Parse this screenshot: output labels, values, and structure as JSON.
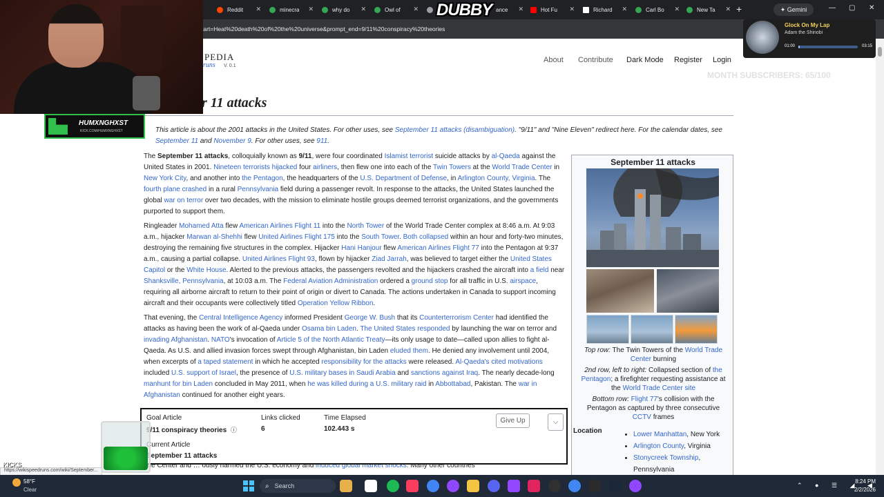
{
  "browser": {
    "tabs": [
      {
        "label": "Reddit",
        "color": "#ff4500"
      },
      {
        "label": "minecra",
        "color": "#34a853"
      },
      {
        "label": "why do",
        "color": "#34a853"
      },
      {
        "label": "Owl of",
        "color": "#34a853"
      },
      {
        "label": "",
        "color": "#9aa0a6"
      },
      {
        "label": "ance",
        "color": "#9aa0a6"
      },
      {
        "label": "Hot Fu",
        "color": "#ff0000"
      },
      {
        "label": "Richard",
        "color": "#ffffff"
      },
      {
        "label": "Carl Bo",
        "color": "#34a853"
      },
      {
        "label": "New Ta",
        "color": "#34a853"
      }
    ],
    "new_tab": "+",
    "gemini": "✦ Gemini",
    "minimize": "—",
    "maximize": "▢",
    "close": "✕",
    "url": "tart=Heat%20death%20of%20the%20universe&prompt_end=9/11%20conspiracy%20theories"
  },
  "site": {
    "logo": "PEDIA",
    "logo_sub": "runs",
    "version": "V. 0.1",
    "nav": [
      "About",
      "Contribute",
      "Dark Mode",
      "Register",
      "Login"
    ]
  },
  "article": {
    "title": "r 11 attacks",
    "hatnote_html": "This article is about the 2001 attacks in the United States. For other uses, see <span class=\"lnk\">September 11 attacks (disambiguation)</span>. \"9/11\" and \"Nine Eleven\" redirect here. For the calendar dates, see <span class=\"lnk\">September 11</span> and <span class=\"lnk\">November 9</span>. For other uses, see <span class=\"lnk\">911</span>.",
    "paragraphs": [
      "The <b>September 11 attacks</b>, colloquially known as <b>9/11</b>, were four coordinated <span class=\"lnk\">Islamist terrorist</span> suicide attacks by <span class=\"lnk\">al-Qaeda</span> against the United States in 2001. <span class=\"lnk\">Nineteen terrorists hijacked</span> four <span class=\"lnk\">airliners</span>, then flew one into each of the <span class=\"lnk\">Twin Towers</span> at the <span class=\"lnk\">World Trade Center</span> in <span class=\"lnk\">New York City</span>, and another into <span class=\"lnk\">the Pentagon</span>, the headquarters of the <span class=\"lnk\">U.S. Department of Defense</span>, in <span class=\"lnk\">Arlington County, Virginia</span>. The <span class=\"lnk\">fourth plane crashed</span> in a rural <span class=\"lnk\">Pennsylvania</span> field during a passenger revolt. In response to the attacks, the United States launched the global <span class=\"lnk\">war on terror</span> over two decades, with the mission to eliminate hostile groups deemed terrorist organizations, and the governments purported to support them.",
      "Ringleader <span class=\"lnk\">Mohamed Atta</span> flew <span class=\"lnk\">American Airlines Flight 11</span> into the <span class=\"lnk\">North Tower</span> of the World Trade Center complex at 8:46 a.m. At 9:03 a.m., hijacker <span class=\"lnk\">Marwan al-Shehhi</span> flew <span class=\"lnk\">United Airlines Flight 175</span> into the <span class=\"lnk\">South Tower</span>. <span class=\"lnk\">Both collapsed</span> within an hour and forty-two minutes, destroying the remaining five structures in the complex. Hijacker <span class=\"lnk\">Hani Hanjour</span> flew <span class=\"lnk\">American Airlines Flight 77</span> into the Pentagon at 9:37 a.m., causing a partial collapse. <span class=\"lnk\">United Airlines Flight 93</span>, flown by hijacker <span class=\"lnk\">Ziad Jarrah</span>, was believed to target either the <span class=\"lnk\">United States Capitol</span> or the <span class=\"lnk\">White House</span>. Alerted to the previous attacks, the passengers revolted and the hijackers crashed the aircraft into <span class=\"lnk\">a field</span> near <span class=\"lnk\">Shanksville, Pennsylvania</span>, at 10:03 a.m. The <span class=\"lnk\">Federal Aviation Administration</span> ordered a <span class=\"lnk\">ground stop</span> for all traffic in U.S. <span class=\"lnk\">airspace</span>, requiring all airborne aircraft to return to their point of origin or divert to Canada. The actions undertaken in Canada to support incoming aircraft and their occupants were collectively titled <span class=\"lnk\">Operation Yellow Ribbon</span>.",
      "That evening, the <span class=\"lnk\">Central Intelligence Agency</span> informed President <span class=\"lnk\">George W. Bush</span> that its <span class=\"lnk\">Counterterrorism Center</span> had identified the attacks as having been the work of al-Qaeda under <span class=\"lnk\">Osama bin Laden</span>. <span class=\"lnk\">The United States responded</span> by launching the war on terror and <span class=\"lnk\">invading Afghanistan</span>. <span class=\"lnk\">NATO</span>'s invocation of <span class=\"lnk\">Article 5 of the North Atlantic Treaty</span>—its only usage to date—called upon allies to fight al-Qaeda. As U.S. and allied invasion forces swept through Afghanistan, bin Laden <span class=\"lnk\">eluded them</span>. He denied any involvement until 2004, when excerpts of <span class=\"lnk\">a taped statement</span> in which he accepted <span class=\"lnk\">responsibility for the attacks</span> were released. <span class=\"lnk\">Al-Qaeda's cited motivations</span> included <span class=\"lnk\">U.S. support of Israel</span>, the presence of <span class=\"lnk\">U.S. military bases in Saudi Arabia</span> and <span class=\"lnk\">sanctions against Iraq</span>. The nearly decade-long <span class=\"lnk\">manhunt for bin Laden</span> concluded in May 2011, when <span class=\"lnk\">he was killed during a U.S. military raid</span> in <span class=\"lnk\">Abbottabad</span>, Pakistan. The <span class=\"lnk\">war in Afghanistan</span> continued for another eight years.",
      "ade Center and … ously harmed the U.S. economy and <span class=\"lnk\">induced global market shocks</span>. Many other countries"
    ]
  },
  "infobox": {
    "title": "September 11 attacks",
    "caption_row1": "<i>Top row:</i> The Twin Towers of the <span class=\"lnk\">World Trade Center</span> burning",
    "caption_row2": "<i>2nd row, left to right:</i> Collapsed section of <span class=\"lnk\">the Pentagon</span>; a firefighter requesting assistance at the <span class=\"lnk\">World Trade Center site</span>",
    "caption_row3": "<i>Bottom row:</i> <span class=\"lnk\">Flight 77</span>'s collision with the Pentagon as captured by three consecutive <span class=\"lnk\">CCTV</span> frames",
    "location_label": "Location",
    "locations_html": [
      "<span class=\"lnk\">Lower Manhattan</span>, New York",
      "<span class=\"lnk\">Arlington County</span>, Virginia",
      "<span class=\"lnk\">Stonycreek Township</span>, Pennsylvania"
    ]
  },
  "game": {
    "goal_label": "Goal Article",
    "goal_value": "9/11 conspiracy theories",
    "goal_info_icon": "ⓘ",
    "links_label": "Links clicked",
    "links_value": "6",
    "time_label": "Time Elapsed",
    "time_value": "102.443 s",
    "current_label": "Current Article",
    "current_value": "September 11 attacks",
    "give_up": "Give Up",
    "toggle": "⌵"
  },
  "overlay": {
    "streamer_name": "HUMXNGHXST",
    "streamer_url": "KICK.COM/HUMXNGHXST",
    "dubby": "DUBBY",
    "music_title": "Glock On My Lap",
    "music_artist": "Adam the Shinobi",
    "music_current": "01:00",
    "music_total": "03:15",
    "subs": "MONTH SUBSCRIBERS: 65/100",
    "kicks": "KICKS",
    "status_url": "https://wikispeedruns.com/wiki/September..."
  },
  "taskbar": {
    "temp": "58°F",
    "weather": "Clear",
    "search": "Search",
    "time": "8:24 PM",
    "date": "2/2/2026",
    "tray": "⌃ ● ☰ ◢ ◀"
  }
}
